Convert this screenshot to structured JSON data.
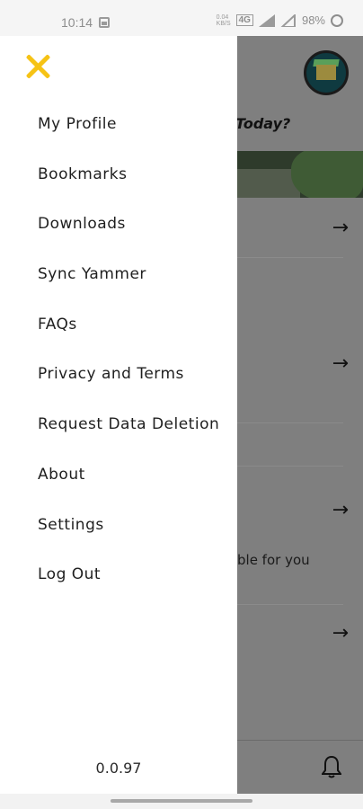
{
  "status_bar": {
    "time": "10:14",
    "net_speed": "0.04\nKB/S",
    "volte": "4G",
    "battery": "98%",
    "icons": [
      "image-icon",
      "signal-icon",
      "battery-icon"
    ]
  },
  "background_app": {
    "heading": "Today?",
    "card_text": "ble for you"
  },
  "drawer": {
    "close_icon": "close-icon",
    "accent_color": "#f6c315",
    "items": [
      {
        "label": "My Profile"
      },
      {
        "label": "Bookmarks"
      },
      {
        "label": "Downloads"
      },
      {
        "label": "Sync Yammer"
      },
      {
        "label": "FAQs"
      },
      {
        "label": "Privacy and Terms"
      },
      {
        "label": "Request Data Deletion"
      },
      {
        "label": "About"
      },
      {
        "label": "Settings"
      },
      {
        "label": "Log Out"
      }
    ],
    "version": "0.0.97"
  }
}
